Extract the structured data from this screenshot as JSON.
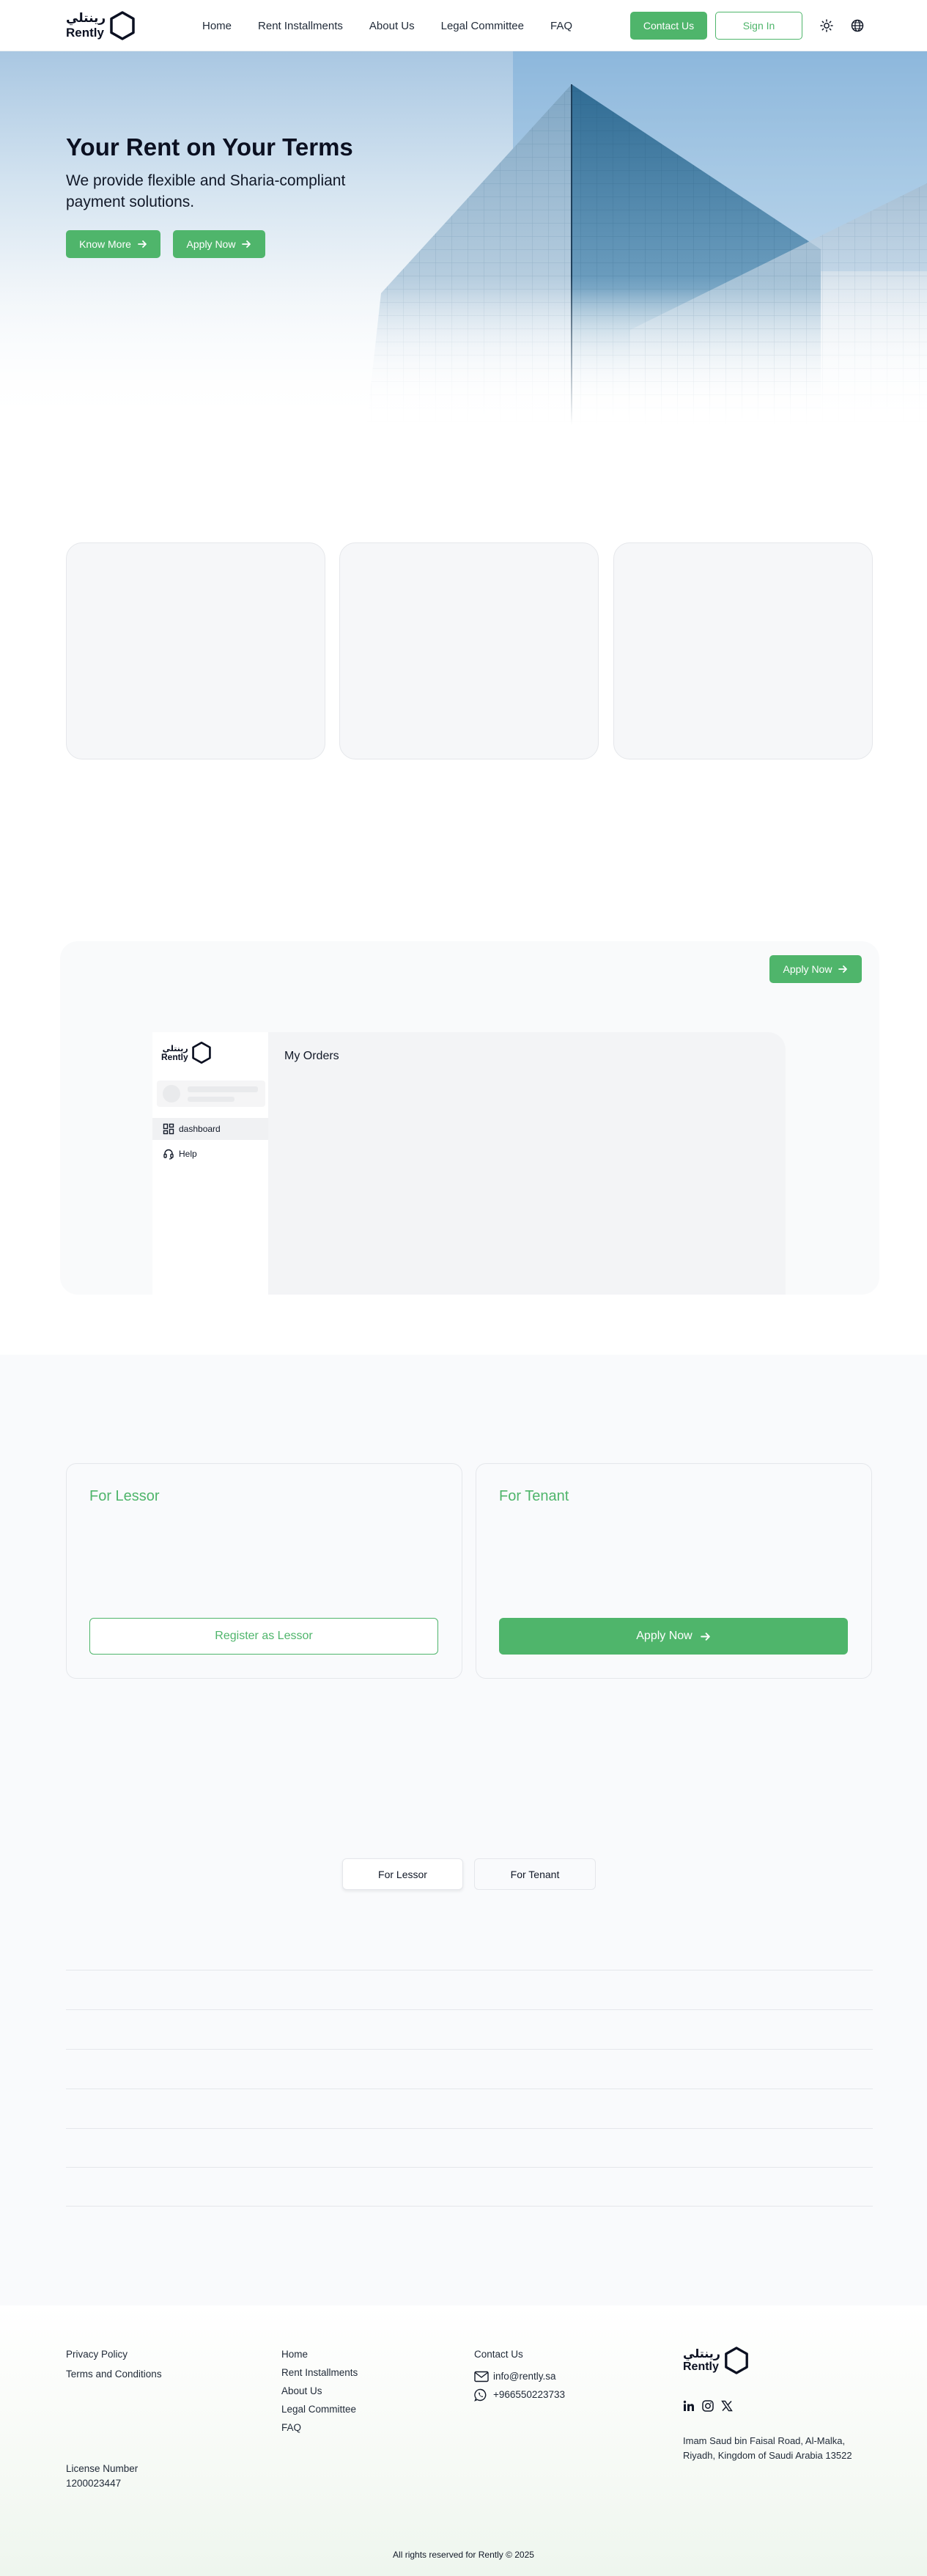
{
  "header": {
    "logo_ar": "رينتلي",
    "logo_en": "Rently",
    "nav": [
      "Home",
      "Rent Installments",
      "About Us",
      "Legal Committee",
      "FAQ"
    ],
    "contact_label": "Contact Us",
    "signin_label": "Sign In",
    "icons": [
      "sun-icon",
      "globe-icon"
    ]
  },
  "hero": {
    "title": "Your Rent on Your Terms",
    "subtitle": "We provide flexible and Sharia-compliant payment solutions.",
    "know_more_label": "Know More",
    "apply_now_label": "Apply Now"
  },
  "dashboard_preview": {
    "apply_now_label": "Apply Now",
    "logo_ar": "رينتلي",
    "logo_en": "Rently",
    "sidebar_items": [
      "dashboard",
      "Help"
    ],
    "main_title": "My Orders"
  },
  "roles": {
    "lessor_title": "For Lessor",
    "lessor_button": "Register as Lessor",
    "tenant_title": "For Tenant",
    "tenant_button": "Apply Now"
  },
  "faq_tabs": {
    "lessor": "For Lessor",
    "tenant": "For Tenant",
    "active": "For Lessor"
  },
  "footer": {
    "legal": [
      "Privacy Policy",
      "Terms and Conditions"
    ],
    "links": [
      "Home",
      "Rent Installments",
      "About Us",
      "Legal Committee",
      "FAQ"
    ],
    "contact_title": "Contact Us",
    "email": "info@rently.sa",
    "phone": "+966550223733",
    "license_label": "License Number",
    "license_number": "1200023447",
    "logo_ar": "رينتلي",
    "logo_en": "Rently",
    "socials": [
      "linkedin-icon",
      "instagram-icon",
      "x-icon"
    ],
    "address_line1": "Imam Saud bin Faisal Road, Al-Malka,",
    "address_line2": "Riyadh, Kingdom of Saudi Arabia 13522",
    "copyright": "All rights reserved for Rently © 2025"
  },
  "colors": {
    "accent": "#4fb56b",
    "dark": "#0b1021",
    "border": "#e5e7eb"
  }
}
